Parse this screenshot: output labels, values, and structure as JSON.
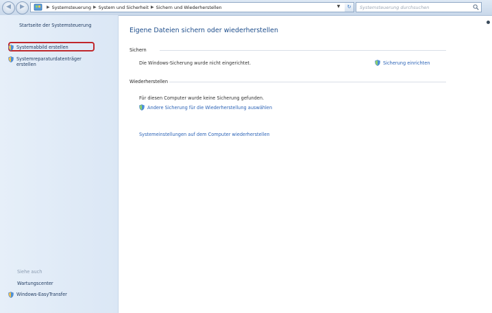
{
  "address_bar": {
    "crumbs": [
      "Systemsteuerung",
      "System und Sicherheit",
      "Sichern und Wiederherstellen"
    ]
  },
  "search": {
    "placeholder": "Systemsteuerung durchsuchen"
  },
  "left_pane": {
    "home_link": "Startseite der Systemsteuerung",
    "tasks": [
      {
        "label": "Systemabbild erstellen",
        "icon": "shield-icon",
        "highlighted": true
      },
      {
        "label": "Systemreparaturdatenträger erstellen",
        "icon": "shield-icon",
        "highlighted": false
      }
    ],
    "see_also": {
      "heading": "Siehe auch",
      "links": [
        {
          "label": "Wartungscenter",
          "icon": null
        },
        {
          "label": "Windows-EasyTransfer",
          "icon": "shield-icon"
        }
      ]
    }
  },
  "main": {
    "title": "Eigene Dateien sichern oder wiederherstellen",
    "backup": {
      "heading": "Sichern",
      "status": "Die Windows-Sicherung wurde nicht eingerichtet.",
      "setup_link": "Sicherung einrichten"
    },
    "restore": {
      "heading": "Wiederherstellen",
      "status": "Für diesen Computer wurde keine Sicherung gefunden.",
      "other_backup_link": "Andere Sicherung für die Wiederherstellung auswählen",
      "system_restore_link": "Systemeinstellungen auf dem Computer wiederherstellen"
    }
  },
  "colors": {
    "link": "#2a62b6",
    "title": "#1e4e8c",
    "highlight_border": "#c0262a",
    "left_pane_bg": "#dbe7f5"
  }
}
